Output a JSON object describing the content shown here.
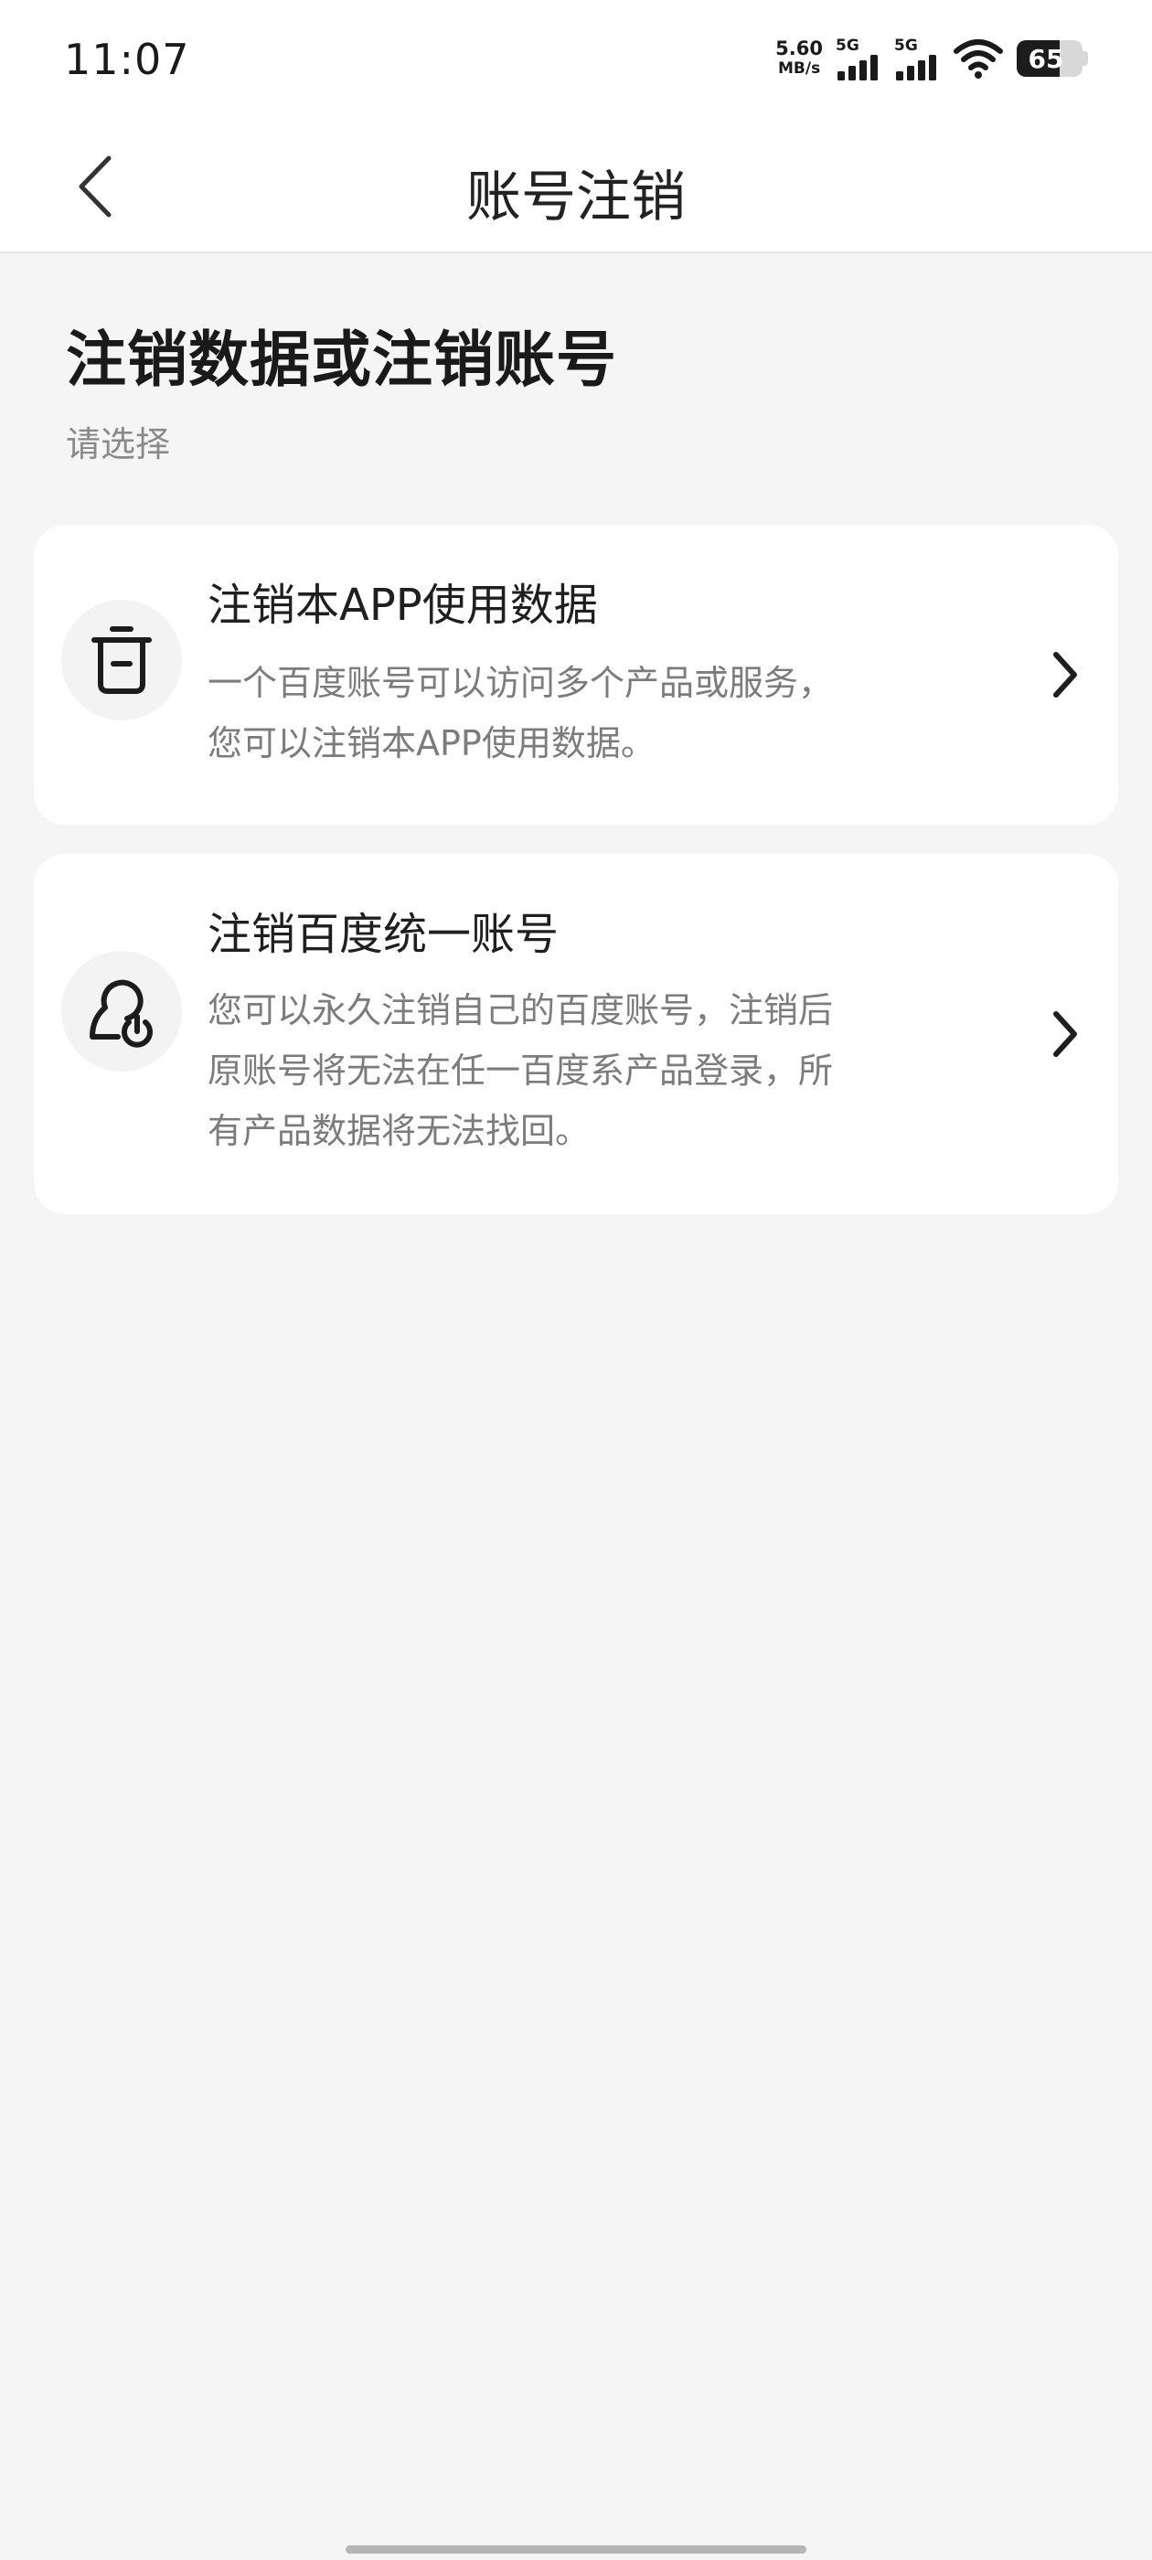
{
  "status_bar": {
    "time": "11:07",
    "net_speed_value": "5.60",
    "net_speed_unit": "MB/s",
    "sim1_tag": "5G",
    "sim2_tag": "5G",
    "battery_level": "65",
    "battery_percent": 65
  },
  "nav": {
    "title": "账号注销",
    "back_icon": "chevron-left-icon"
  },
  "header": {
    "title": "注销数据或注销账号",
    "subtitle": "请选择"
  },
  "options": [
    {
      "title": "注销本APP使用数据",
      "desc_lines": [
        "一个百度账号可以访问多个产品或服务，",
        "您可以注销本APP使用数据。"
      ],
      "icon": "trash-icon"
    },
    {
      "title": "注销百度统一账号",
      "desc_lines": [
        "您可以永久注销自己的百度账号，注销后",
        "原账号将无法在任一百度系产品登录，所",
        "有产品数据将无法找回。"
      ],
      "icon": "user-power-icon"
    }
  ],
  "colors": {
    "background": "#f5f5f5",
    "card": "#ffffff",
    "text_primary": "#1f1f1f",
    "text_secondary": "#7c7c7c"
  }
}
